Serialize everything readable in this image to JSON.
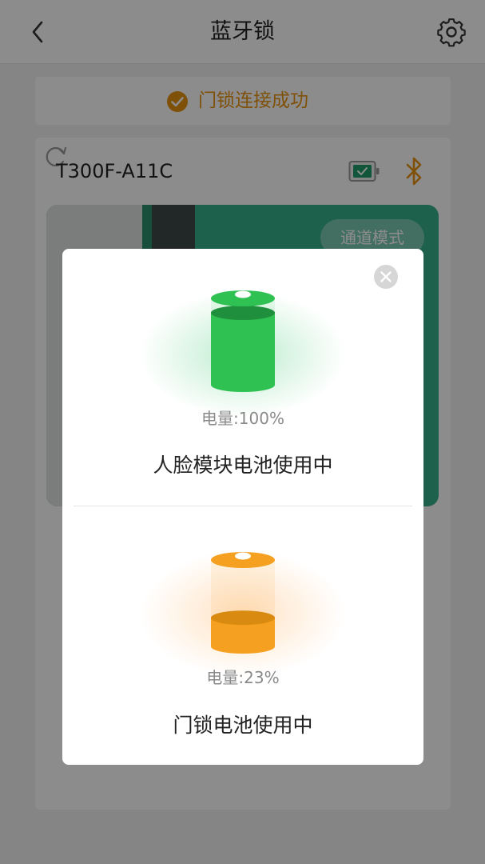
{
  "header": {
    "title": "蓝牙锁",
    "back_icon": "chevron-left-icon",
    "settings_icon": "gear-icon"
  },
  "connection": {
    "status_text": "门锁连接成功",
    "status_icon": "check-circle-icon",
    "accent_color": "#e8920f"
  },
  "device": {
    "name": "T300F-A11C",
    "battery_icon": "battery-icon",
    "bluetooth_icon": "bluetooth-icon",
    "mode_label": "通道模式",
    "panel_color": "#35b08a"
  },
  "battery_dialog": {
    "close_icon": "close-icon",
    "face_module": {
      "level_text": "电量:100%",
      "level_fraction": 1.0,
      "label": "人脸模块电池使用中",
      "color": "#2fc253"
    },
    "door_lock": {
      "level_text": "电量:23%",
      "level_fraction": 0.23,
      "label": "门锁电池使用中",
      "color": "#f5a020"
    }
  }
}
